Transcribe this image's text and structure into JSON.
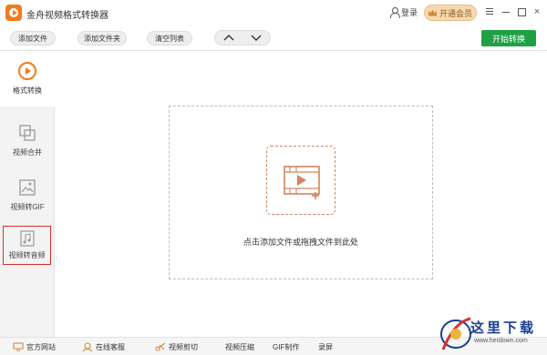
{
  "window": {
    "title": "金舟视频格式转换器",
    "login_label": "登录",
    "vip_label": "开通会员",
    "close_glyph": "×"
  },
  "toolbar": {
    "add_file": "添加文件",
    "add_folder": "添加文件夹",
    "clear_list": "清空列表",
    "start_convert": "开始转换"
  },
  "sidebar": {
    "items": [
      {
        "label": "格式转换",
        "icon": "format-convert-icon",
        "active": true
      },
      {
        "label": "视频合并",
        "icon": "video-merge-icon"
      },
      {
        "label": "视频转GIF",
        "icon": "video-to-gif-icon"
      },
      {
        "label": "视频转音频",
        "icon": "video-to-audio-icon",
        "highlighted": true
      }
    ]
  },
  "main": {
    "drop_hint": "点击添加文件或拖拽文件到此处"
  },
  "bottombar": {
    "items": [
      {
        "label": "官方网站",
        "icon": "website-icon"
      },
      {
        "label": "在线客服",
        "icon": "support-icon"
      },
      {
        "label": "视频剪切",
        "icon": "scissors-icon"
      },
      {
        "label": "视频压缩"
      },
      {
        "label": "GIF制作"
      },
      {
        "label": "录屏"
      }
    ]
  },
  "watermark": {
    "text": "这里下载",
    "url": "www.herdown.com"
  },
  "colors": {
    "accent": "#f07c1e",
    "start_button": "#1fa045",
    "highlight_border": "#d9302c",
    "drop_icon": "#d3845a"
  }
}
